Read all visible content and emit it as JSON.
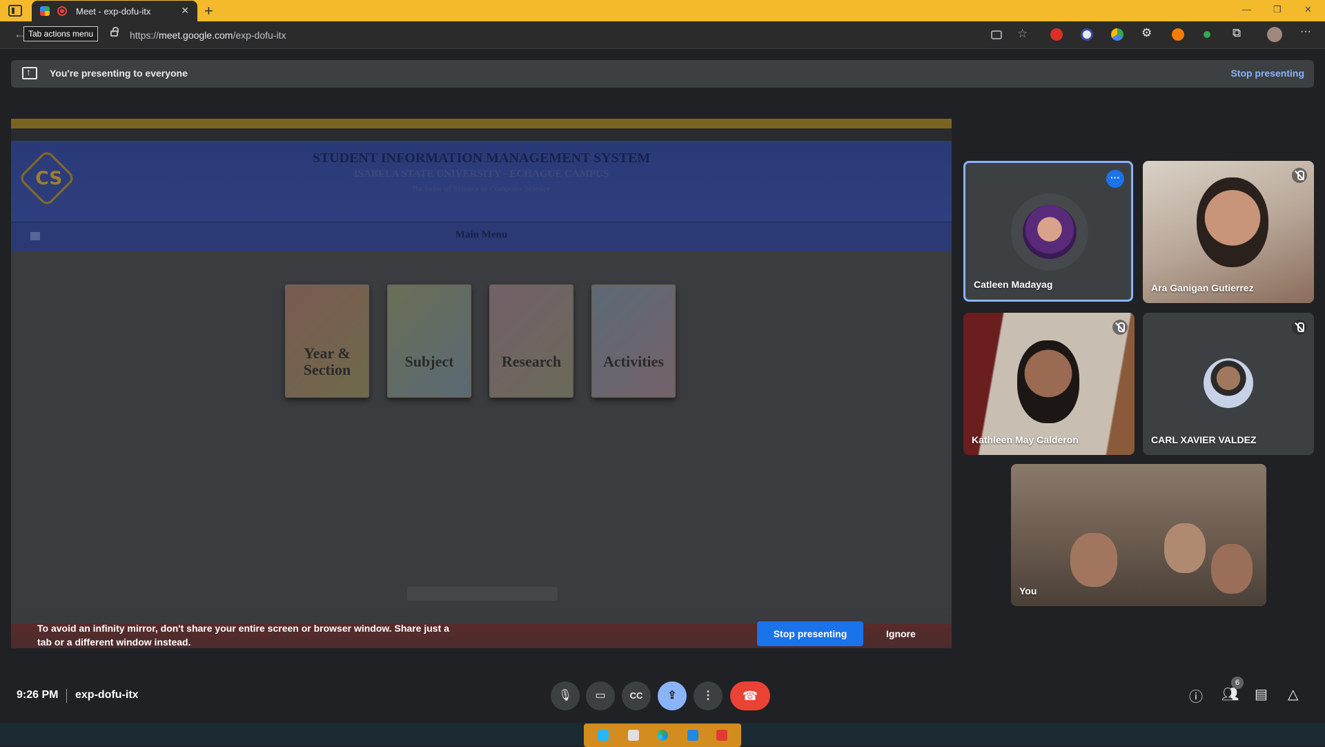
{
  "browser": {
    "tab_title": "Meet - exp-dofu-itx",
    "tooltip": "Tab actions menu",
    "url_prefix": "https://",
    "url_domain": "meet.google.com",
    "url_path": "/exp-dofu-itx",
    "accent": "#f4ba2b"
  },
  "banner": {
    "message": "You're presenting to everyone",
    "stop_label": "Stop presenting"
  },
  "shared_screen": {
    "title": "STUDENT INFORMATION MANAGEMENT SYSTEM",
    "subtitle": "ISABELA STATE UNIVERSITY - ECHAGUE CAMPUS",
    "program": "Bachelor of Science in Computer Science",
    "menu_title": "Main Menu",
    "cards": [
      "Year & Section",
      "Subject",
      "Research",
      "Activities"
    ]
  },
  "infinity_warning": {
    "message": "To avoid an infinity mirror, don't share your entire screen or browser window. Share just a tab or a different window instead.",
    "stop_label": "Stop presenting",
    "ignore_label": "Ignore"
  },
  "participants": [
    {
      "name": "Catleen Madayag",
      "speaking": true
    },
    {
      "name": "Ara Ganigan Gutierrez",
      "muted": true
    },
    {
      "name": "Kathleen May Calderon",
      "muted": true
    },
    {
      "name": "CARL XAVIER VALDEZ",
      "muted": true
    },
    {
      "name": "You"
    }
  ],
  "meeting": {
    "time": "9:26 PM",
    "code": "exp-dofu-itx",
    "participant_count": "6"
  },
  "colors": {
    "primary_blue": "#1a73e8",
    "end_call_red": "#ea4335",
    "link_blue": "#8ab4f8"
  }
}
